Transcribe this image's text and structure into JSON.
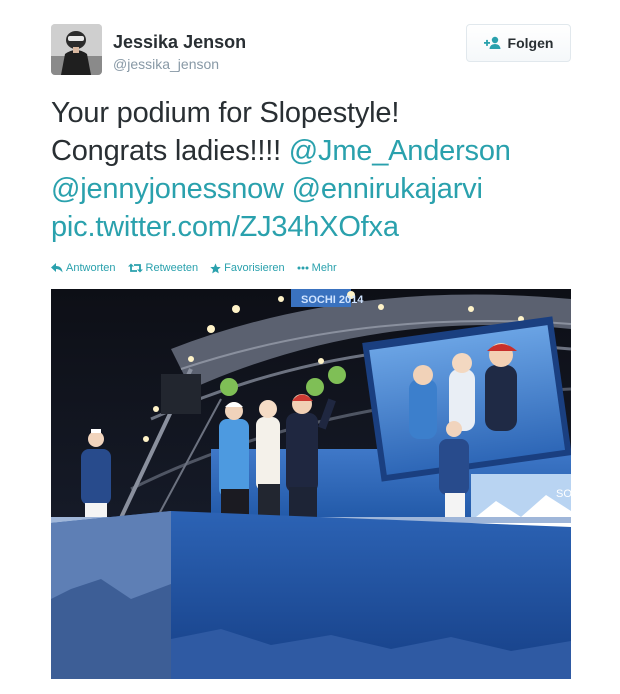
{
  "tweet": {
    "author": {
      "fullname": "Jessika Jenson",
      "username": "@jessika_jenson",
      "avatar_icon": "user-photo-icon"
    },
    "follow_button": {
      "label": "Folgen",
      "icon": "add-user-icon"
    },
    "text": {
      "line1": "Your podium for Slopestyle!",
      "line2_plain": "Congrats ladies!!!! ",
      "mention1": "@Jme_Anderson",
      "mention2": "@jennyjonessnow",
      "mention3": "@ennirukajarvi",
      "space": " ",
      "link": "pic.twitter.com/ZJ34hXOfxa"
    },
    "actions": [
      {
        "label": "Antworten",
        "icon": "reply-icon"
      },
      {
        "label": "Retweeten",
        "icon": "retweet-icon"
      },
      {
        "label": "Favorisieren",
        "icon": "star-icon"
      },
      {
        "label": "Mehr",
        "icon": "more-icon"
      }
    ],
    "media": {
      "banner_text": "SOCHI 2014",
      "screen_edge_text": "SO",
      "link_color": "#2aa1ad",
      "stage_blue": "#1c4f96"
    }
  }
}
